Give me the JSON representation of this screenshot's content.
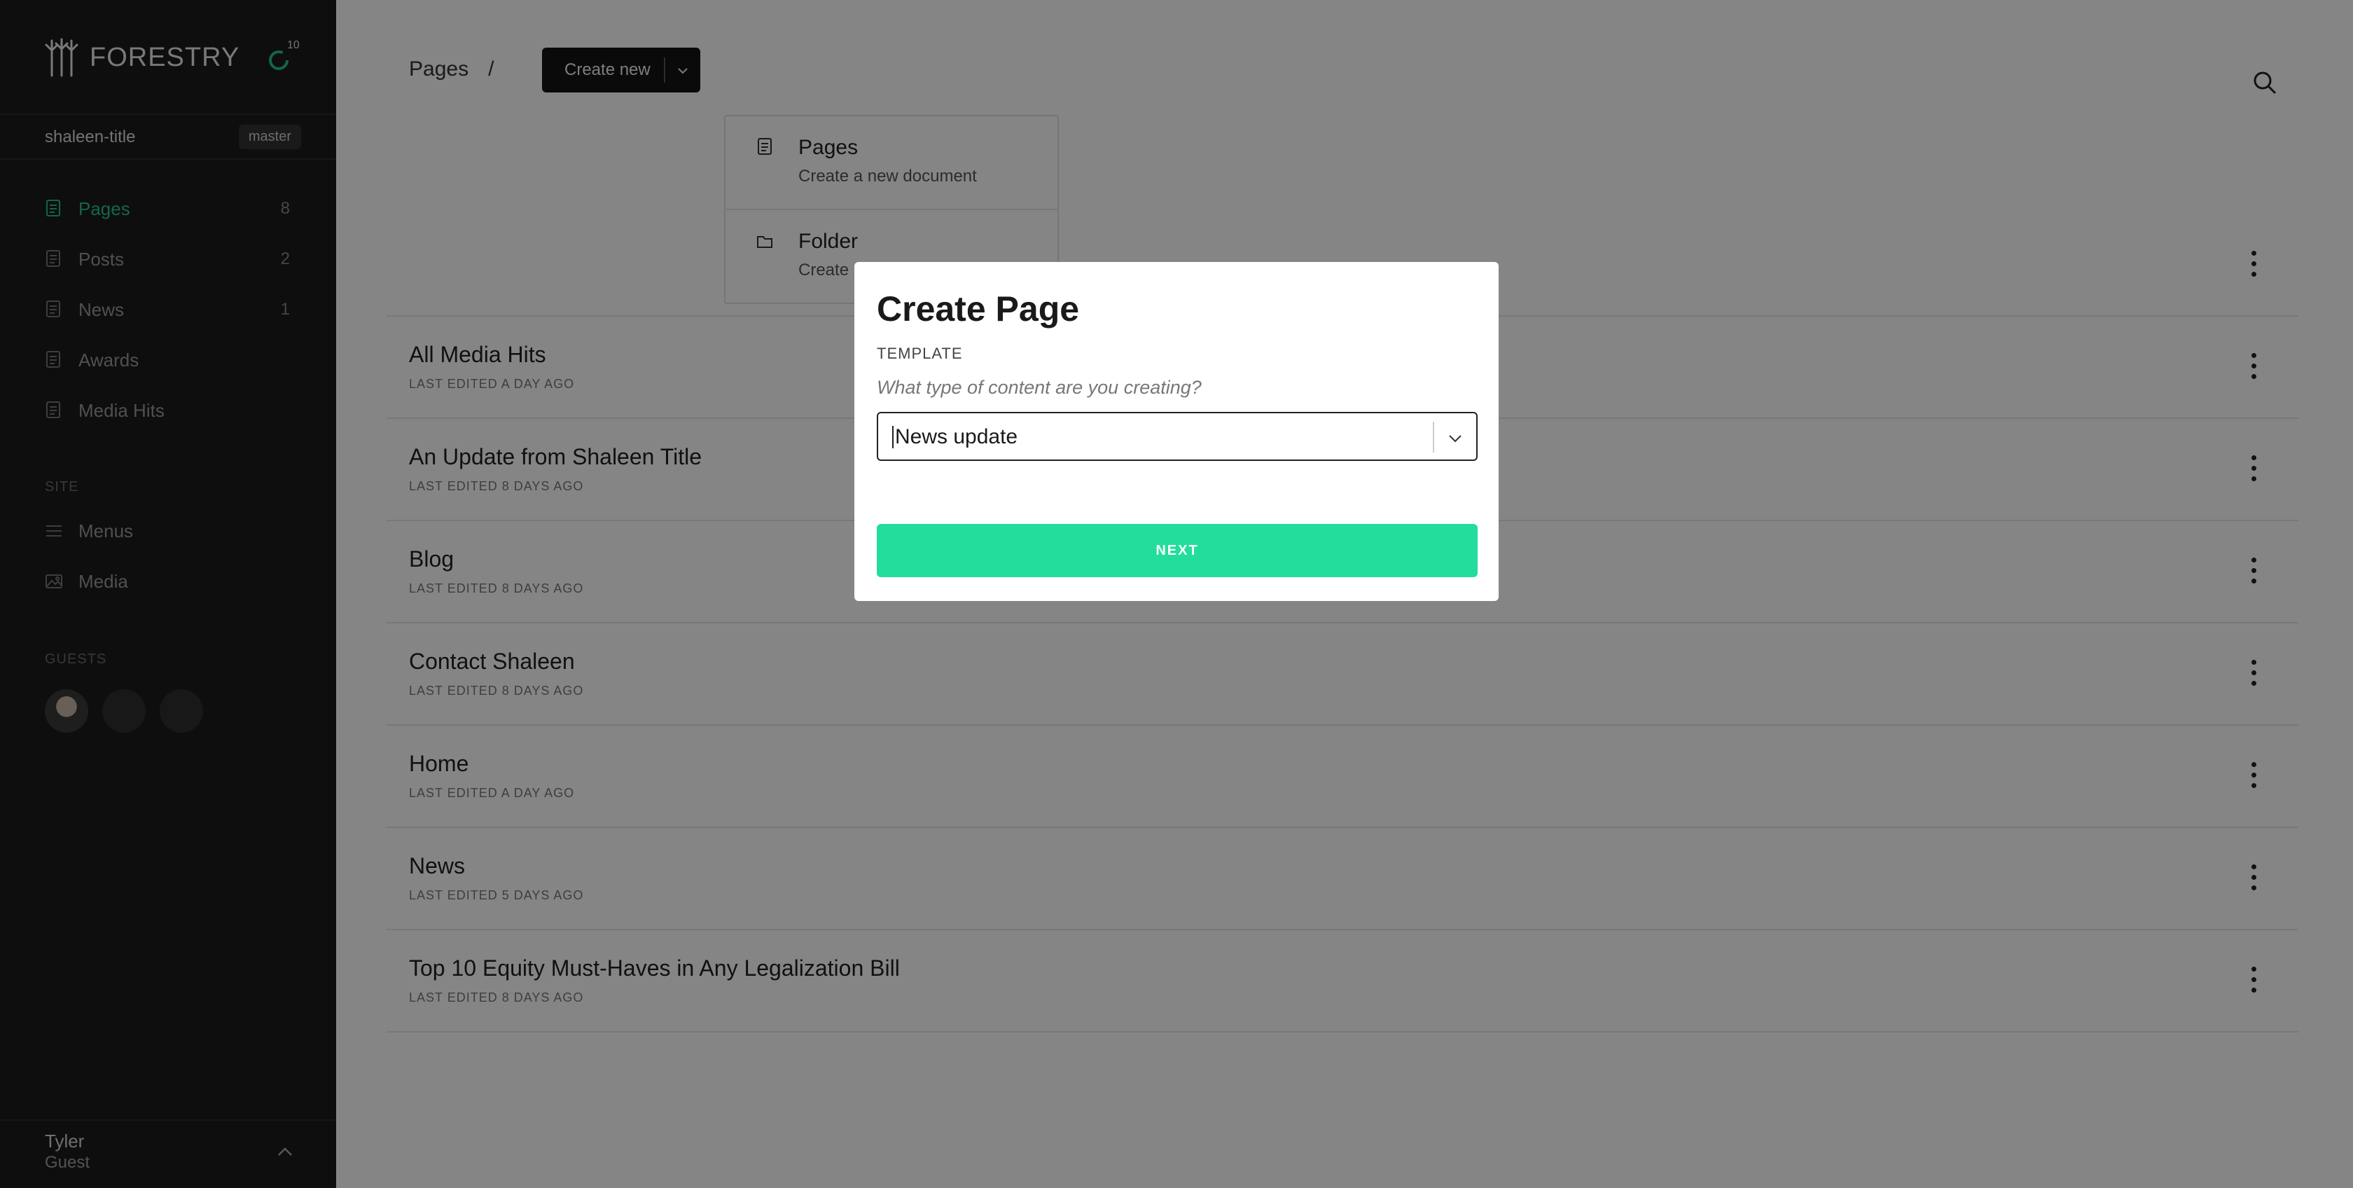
{
  "sidebar": {
    "brand": "FORESTRY",
    "sync_count": "10",
    "repo": "shaleen-title",
    "branch": "master",
    "content_items": [
      {
        "label": "Pages",
        "count": "8",
        "icon": "document-icon"
      },
      {
        "label": "Posts",
        "count": "2",
        "icon": "document-icon"
      },
      {
        "label": "News",
        "count": "1",
        "icon": "document-icon"
      },
      {
        "label": "Awards",
        "count": "",
        "icon": "document-icon"
      },
      {
        "label": "Media Hits",
        "count": "",
        "icon": "document-icon"
      }
    ],
    "site_label": "SITE",
    "site_items": [
      {
        "label": "Menus",
        "icon": "menu-icon"
      },
      {
        "label": "Media",
        "icon": "image-icon"
      }
    ],
    "guests_label": "GUESTS",
    "user": {
      "name": "Tyler",
      "role": "Guest"
    }
  },
  "header": {
    "breadcrumb": "Pages",
    "breadcrumb_sep": "/",
    "create_label": "Create new"
  },
  "dropdown": [
    {
      "title": "Pages",
      "subtitle": "Create a new document",
      "icon": "document-icon"
    },
    {
      "title": "Folder",
      "subtitle": "Create a new empty folder",
      "icon": "folder-icon"
    }
  ],
  "pages": [
    {
      "title": "",
      "meta": ""
    },
    {
      "title": "All Media Hits",
      "meta": "LAST EDITED A DAY AGO"
    },
    {
      "title": "An Update from Shaleen Title",
      "meta": "LAST EDITED 8 DAYS AGO"
    },
    {
      "title": "Blog",
      "meta": "LAST EDITED 8 DAYS AGO"
    },
    {
      "title": "Contact Shaleen",
      "meta": "LAST EDITED 8 DAYS AGO"
    },
    {
      "title": "Home",
      "meta": "LAST EDITED A DAY AGO"
    },
    {
      "title": "News",
      "meta": "LAST EDITED 5 DAYS AGO"
    },
    {
      "title": "Top 10 Equity Must-Haves in Any Legalization Bill",
      "meta": "LAST EDITED 8 DAYS AGO"
    }
  ],
  "modal": {
    "title": "Create Page",
    "field_label": "TEMPLATE",
    "field_hint": "What type of content are you creating?",
    "selected_template": "News update",
    "next_label": "NEXT"
  },
  "colors": {
    "accent": "#27c093",
    "next_button": "#22dd9c",
    "sidebar_bg": "#1b1b1b"
  }
}
